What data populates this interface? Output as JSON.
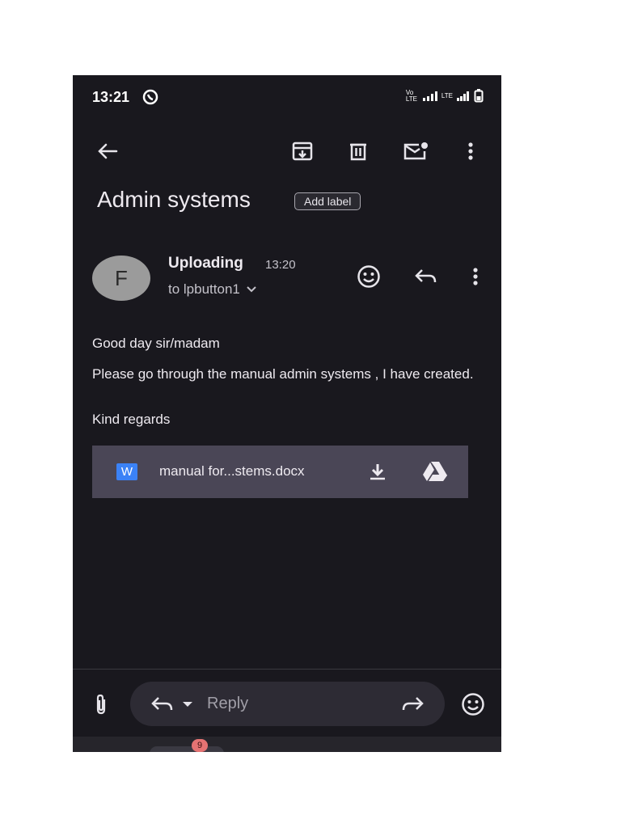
{
  "status_bar": {
    "time": "13:21",
    "network": "Vo LTE",
    "lte": "LTE"
  },
  "toolbar": {
    "back_icon": "arrow-left-icon",
    "archive_icon": "archive-icon",
    "delete_icon": "trash-icon",
    "mark_unread_icon": "mail-unread-icon",
    "more_icon": "more-vert-icon"
  },
  "email": {
    "subject": "Admin systems",
    "label_chip": "Add label",
    "avatar_initial": "F",
    "sender": "Uploading",
    "time": "13:20",
    "recipient": "to lpbutton1",
    "body": {
      "greeting": "Good day sir/madam",
      "line1": "Please go through the manual admin systems , I have created.",
      "signoff": "Kind regards"
    },
    "attachment": {
      "type_icon": "W",
      "filename": "manual for...stems.docx"
    }
  },
  "reply_bar": {
    "placeholder": "Reply"
  },
  "bottom_nav": {
    "badge": "9"
  },
  "colors": {
    "background": "#19181e",
    "attachment_bg": "#4a4656",
    "word_blue": "#3b82f6",
    "badge": "#e57373"
  }
}
